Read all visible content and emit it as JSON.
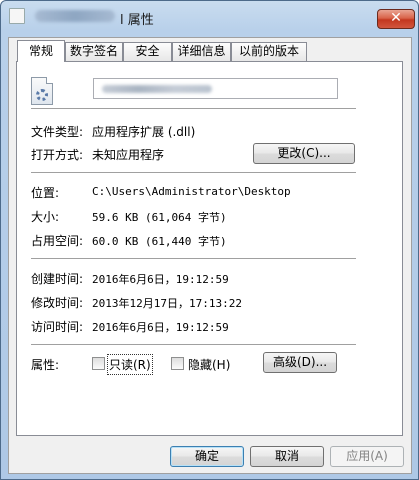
{
  "window": {
    "title_suffix": "l 属性",
    "close_glyph": "✕"
  },
  "tabs": [
    {
      "label": "常规"
    },
    {
      "label": "数字签名"
    },
    {
      "label": "安全"
    },
    {
      "label": "详细信息"
    },
    {
      "label": "以前的版本"
    }
  ],
  "general": {
    "file_type_label": "文件类型:",
    "file_type_value": "应用程序扩展 (.dll)",
    "opens_with_label": "打开方式:",
    "opens_with_value": "未知应用程序",
    "change_button": "更改(C)...",
    "location_label": "位置:",
    "location_value": "C:\\Users\\Administrator\\Desktop",
    "size_label": "大小:",
    "size_value": "59.6 KB (61,064 字节)",
    "size_on_disk_label": "占用空间:",
    "size_on_disk_value": "60.0 KB (61,440 字节)",
    "created_label": "创建时间:",
    "created_value": "2016年6月6日，19:12:59",
    "modified_label": "修改时间:",
    "modified_value": "2013年12月17日，17:13:22",
    "accessed_label": "访问时间:",
    "accessed_value": "2016年6月6日，19:12:59",
    "attributes_label": "属性:",
    "readonly_label": "只读(R)",
    "hidden_label": "隐藏(H)",
    "advanced_button": "高级(D)..."
  },
  "footer": {
    "ok": "确定",
    "cancel": "取消",
    "apply": "应用(A)"
  }
}
